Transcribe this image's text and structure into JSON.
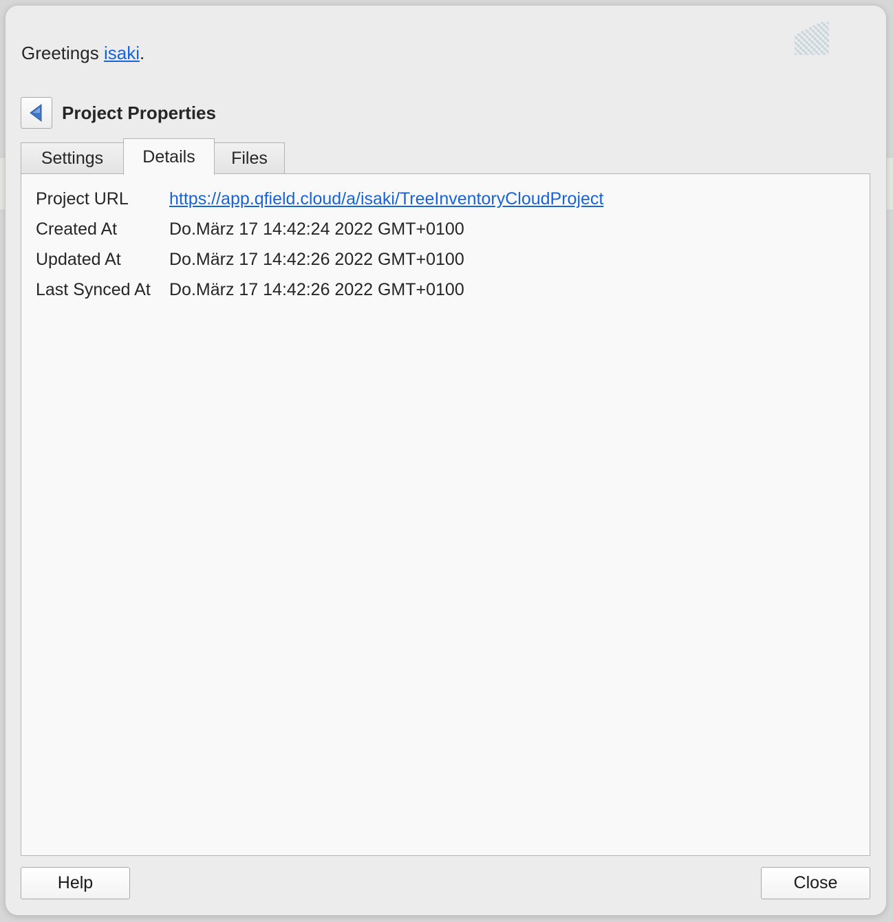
{
  "greeting": {
    "prefix": "Greetings ",
    "username": "isaki",
    "suffix": "."
  },
  "avatar": {
    "icon": "user-avatar-icon"
  },
  "header": {
    "back_icon": "back-arrow-icon",
    "title": "Project Properties"
  },
  "tabs": [
    {
      "label": "Settings",
      "active": false
    },
    {
      "label": "Details",
      "active": true
    },
    {
      "label": "Files",
      "active": false
    }
  ],
  "details": {
    "rows": [
      {
        "label": "Project URL",
        "value": "https://app.qfield.cloud/a/isaki/TreeInventoryCloudProject",
        "is_link": true
      },
      {
        "label": "Created At",
        "value": "Do.März 17 14:42:24 2022 GMT+0100",
        "is_link": false
      },
      {
        "label": "Updated At",
        "value": "Do.März 17 14:42:26 2022 GMT+0100",
        "is_link": false
      },
      {
        "label": "Last Synced At",
        "value": "Do.März 17 14:42:26 2022 GMT+0100",
        "is_link": false
      }
    ]
  },
  "footer": {
    "help_label": "Help",
    "close_label": "Close"
  },
  "colors": {
    "link": "#1863d6",
    "dialog_bg": "#ececec",
    "content_bg": "#f9f9f9",
    "back_arrow": "#3f77c4"
  }
}
